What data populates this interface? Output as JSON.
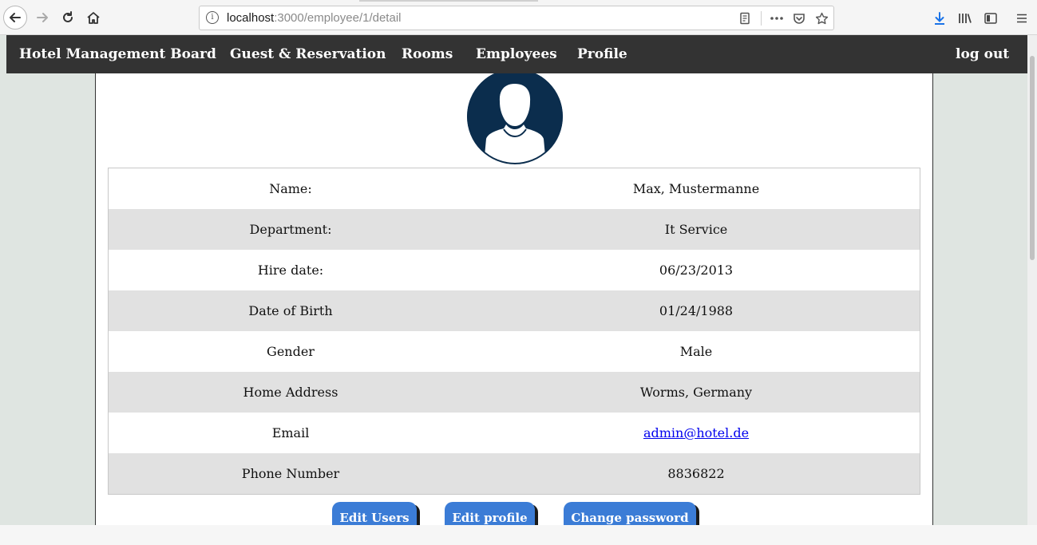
{
  "browser": {
    "url_host": "localhost",
    "url_rest": ":3000/employee/1/detail"
  },
  "nav": {
    "brand": "Hotel Management Board",
    "items": [
      "Guest & Reservation",
      "Rooms",
      "Employees",
      "Profile"
    ],
    "logout": "log out"
  },
  "employee": {
    "fields": [
      {
        "label": "Name:",
        "value": "Max, Mustermanne"
      },
      {
        "label": "Department:",
        "value": "It Service"
      },
      {
        "label": "Hire date:",
        "value": "06/23/2013"
      },
      {
        "label": "Date of Birth",
        "value": "01/24/1988"
      },
      {
        "label": "Gender",
        "value": "Male"
      },
      {
        "label": "Home Address",
        "value": "Worms, Germany"
      },
      {
        "label": "Email",
        "value": "admin@hotel.de"
      },
      {
        "label": "Phone Number",
        "value": "8836822"
      }
    ]
  },
  "actions": {
    "edit_users": "Edit Users",
    "edit_profile": "Edit profile",
    "change_password": "Change password"
  },
  "colors": {
    "navbar": "#333333",
    "avatar_bg": "#0b2d4d",
    "button": "#3b7cd6",
    "row_alt": "#e1e1e1",
    "page_bg": "#dfe5e1"
  }
}
